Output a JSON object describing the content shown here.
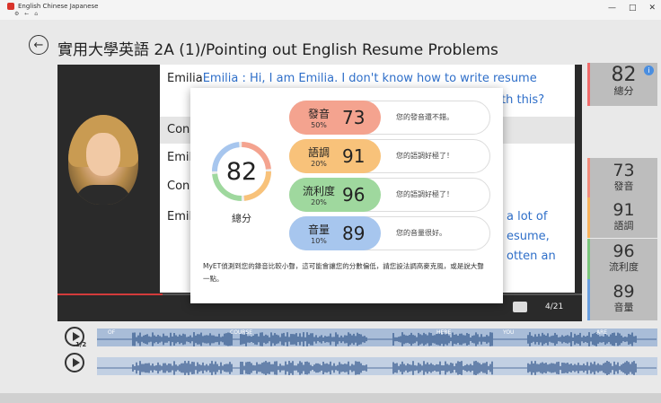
{
  "window": {
    "title": "English Chinese Japanese",
    "menu": "⚙ ← ⌂",
    "controls": [
      "—",
      "□",
      "✕"
    ]
  },
  "header": {
    "back_icon": "←",
    "title": "實用大學英語 2A (1)/Pointing out English Resume Problems"
  },
  "dialog": {
    "lines": [
      {
        "text": "Emilia        :  Hi, I am Emilia. I don't know how to write resume",
        "color": "mixed"
      },
      {
        "text": "th this?",
        "color": "blue"
      },
      {
        "text": "Con",
        "color": "dark"
      },
      {
        "text": "Emil",
        "color": "dark"
      },
      {
        "text": "Con",
        "color": "dark"
      },
      {
        "text": "Emil",
        "color": "dark"
      },
      {
        "text": "a lot of",
        "color": "blue"
      },
      {
        "text": "esume,",
        "color": "blue"
      },
      {
        "text": "otten an",
        "color": "blue"
      }
    ]
  },
  "player": {
    "page_counter": "4/21",
    "progress": 0.2,
    "half_speed_label": "1/2",
    "wave_labels": [
      "OF",
      "COURSE",
      "HERE",
      "YOU",
      "ARE"
    ]
  },
  "side_scores": {
    "total": {
      "score": "82",
      "label": "總分",
      "info_icon": "i"
    },
    "items": [
      {
        "score": "73",
        "label": "發音"
      },
      {
        "score": "91",
        "label": "語調"
      },
      {
        "score": "96",
        "label": "流利度"
      },
      {
        "score": "89",
        "label": "音量"
      }
    ]
  },
  "modal": {
    "total_score": "82",
    "total_label": "總分",
    "gauge_value": 0.82,
    "metrics": [
      {
        "name": "發音",
        "weight": "50%",
        "score": "73",
        "comment": "您的發音還不錯。",
        "color": "#f4a38f"
      },
      {
        "name": "語調",
        "weight": "20%",
        "score": "91",
        "comment": "您的語調好極了！",
        "color": "#f8c27a"
      },
      {
        "name": "流利度",
        "weight": "20%",
        "score": "96",
        "comment": "您的語調好極了！",
        "color": "#9fd89e"
      },
      {
        "name": "音量",
        "weight": "10%",
        "score": "89",
        "comment": "您的音量很好。",
        "color": "#a7c6ee"
      }
    ],
    "note": "MyET偵測到您的錄音比較小聲，這可能會讓您的分數偏低，請您設法調高麥克風，或是說大聲一點。"
  },
  "colors": {
    "accent_blue": "#2f6fc9",
    "progress_red": "#d23b3b",
    "gauge_segments": [
      "#f4a38f",
      "#f8c27a",
      "#9fd89e",
      "#a7c6ee"
    ]
  }
}
